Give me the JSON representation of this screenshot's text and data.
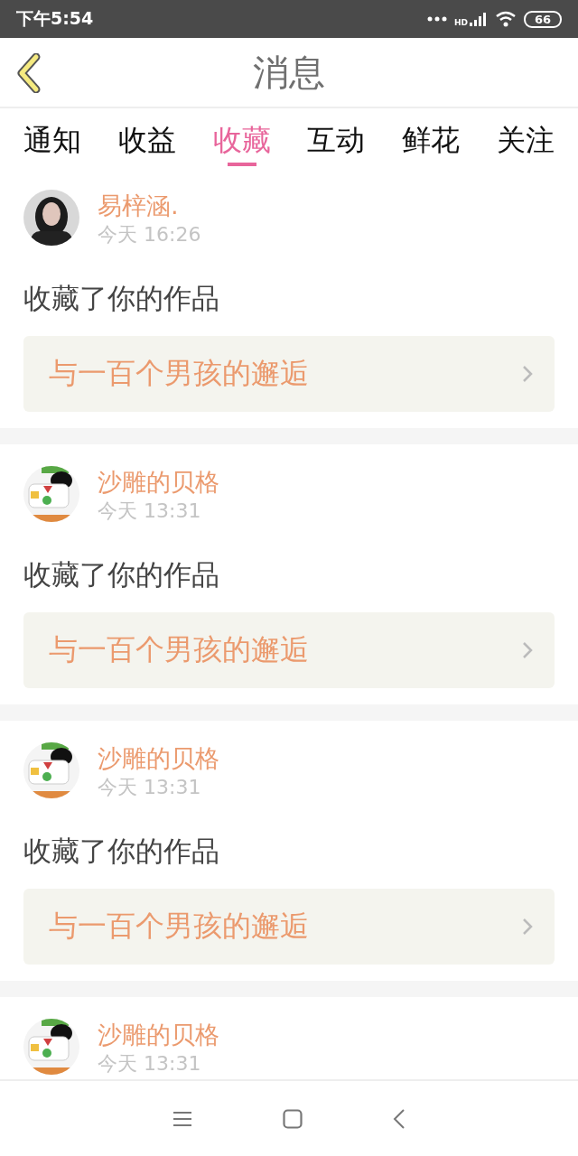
{
  "status_bar": {
    "time": "下午5:54",
    "network": "HD",
    "battery": "66"
  },
  "header": {
    "title": "消息"
  },
  "tabs": [
    {
      "label": "通知",
      "selected": false
    },
    {
      "label": "收益",
      "selected": false
    },
    {
      "label": "收藏",
      "selected": true
    },
    {
      "label": "互动",
      "selected": false
    },
    {
      "label": "鲜花",
      "selected": false
    },
    {
      "label": "关注",
      "selected": false
    }
  ],
  "messages": [
    {
      "name": "易梓涵.",
      "time": "今天 16:26",
      "action": "收藏了你的作品",
      "work": "与一百个男孩的邂逅"
    },
    {
      "name": "沙雕的贝格",
      "time": "今天 13:31",
      "action": "收藏了你的作品",
      "work": "与一百个男孩的邂逅"
    },
    {
      "name": "沙雕的贝格",
      "time": "今天 13:31",
      "action": "收藏了你的作品",
      "work": "与一百个男孩的邂逅"
    },
    {
      "name": "沙雕的贝格",
      "time": "今天 13:31"
    }
  ]
}
